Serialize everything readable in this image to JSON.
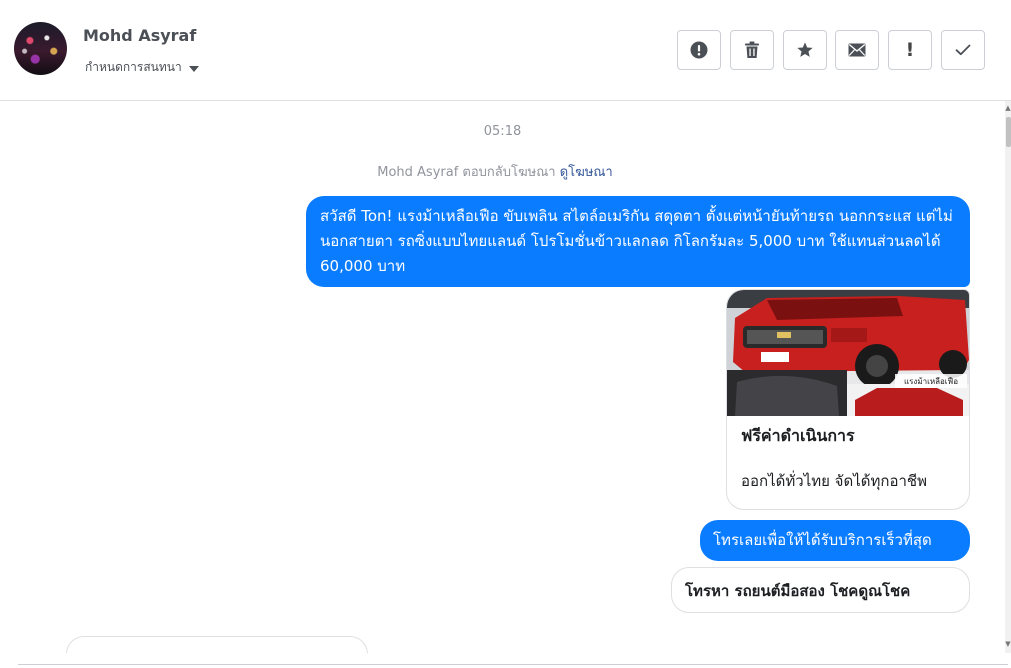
{
  "header": {
    "contact_name": "Mohd Asyraf",
    "settings_label": "กำหนดการสนทนา",
    "tools": [
      {
        "name": "report-spam-button",
        "icon": "alert-circle-icon"
      },
      {
        "name": "delete-button",
        "icon": "trash-icon"
      },
      {
        "name": "star-button",
        "icon": "star-icon"
      },
      {
        "name": "mark-unread-button",
        "icon": "envelope-icon"
      },
      {
        "name": "follow-up-button",
        "icon": "exclamation-icon",
        "glyph": "!"
      },
      {
        "name": "mark-done-button",
        "icon": "check-icon"
      }
    ]
  },
  "chat": {
    "timestamp": "05:18",
    "ad_reply_text": "Mohd Asyraf ตอบกลับโฆษณา",
    "ad_reply_link": "ดูโฆษณา",
    "messages": [
      {
        "type": "text",
        "text": "สวัสดี Ton! แรงม้าเหลือเฟือ ขับเพลิน สไตล์อเมริกัน สดุดตา ตั้งแต่หน้ายันท้ายรถ นอกกระแส แต่ไม่นอกสายตา รถซิ่งแบบไทยแลนด์ โปรโมชั่นข้าวแลกลด กิโลกรัมละ 5,000 บาท ใช้แทนส่วนลดได้ 60,000 บาท"
      },
      {
        "type": "card",
        "title": "ฟรีค่าดำเนินการ",
        "subtitle": "ออกได้ทั่วไทย จัดได้ทุกอาชีพ",
        "image_icon": "car-photo-icon",
        "image_caption": "แรงม้าเหลือเฟือ"
      },
      {
        "type": "text",
        "text": "โทรเลยเพื่อให้ได้รับบริการเร็วที่สุด"
      },
      {
        "type": "quick_reply",
        "text": "โทรหา รถยนต์มือสอง โชคดูณโชค"
      }
    ]
  },
  "colors": {
    "bubble_blue": "#0a7cff",
    "link": "#365899",
    "muted": "#90949c",
    "border": "#dddfe2"
  }
}
